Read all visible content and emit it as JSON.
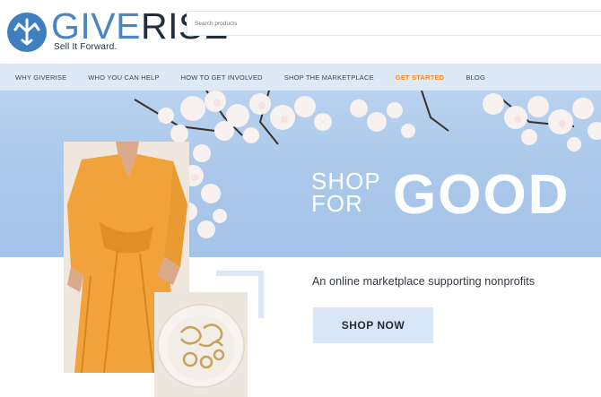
{
  "brand": {
    "name_part1": "GIVE",
    "name_part2": "RISE",
    "tagline": "Sell It Forward.",
    "colors": {
      "blue": "#4a86c4",
      "dark": "#1f2d3d"
    }
  },
  "search": {
    "placeholder": "Search products"
  },
  "nav": {
    "items": [
      {
        "label": "WHY GIVERISE"
      },
      {
        "label": "WHO YOU CAN HELP"
      },
      {
        "label": "HOW TO GET INVOLVED"
      },
      {
        "label": "SHOP THE MARKETPLACE"
      },
      {
        "label": "GET STARTED",
        "accent": "#f08a24"
      },
      {
        "label": "BLOG"
      }
    ]
  },
  "hero": {
    "shop": "SHOP",
    "for": "FOR",
    "good": "GOOD"
  },
  "main": {
    "tagline": "An online marketplace supporting nonprofits",
    "cta_label": "SHOP NOW"
  }
}
